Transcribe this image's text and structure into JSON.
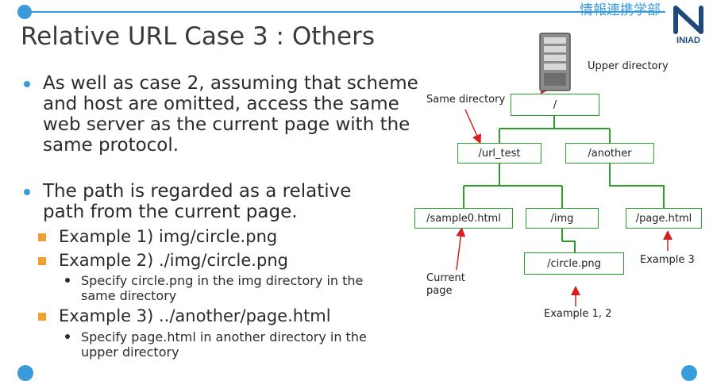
{
  "header": {
    "department": "情報連携学部",
    "logo_text": "INIAD",
    "accent": "#3a9bdc"
  },
  "slide": {
    "title": "Relative URL Case 3 : Others",
    "bullets": [
      "As well as case 2, assuming that scheme and host are omitted, access the same web server as the current page with the same protocol.",
      "The path is regarded as a relative path from the current page."
    ],
    "examples": [
      "Example 1) img/circle.png",
      "Example 2) ./img/circle.png",
      "Example 3) ../another/page.html"
    ],
    "example2_note": "Specify circle.png in the img directory in the same directory",
    "example3_note": "Specify page.html in another directory in the upper directory"
  },
  "diagram": {
    "upper_label": "Upper directory",
    "same_label": "Same directory",
    "current_label": "Current page",
    "ex12_label": "Example 1, 2",
    "ex3_label": "Example 3",
    "nodes": {
      "root": "/",
      "url_test": "/url_test",
      "another": "/another",
      "sample0": "/sample0.html",
      "img": "/img",
      "page": "/page.html",
      "circle": "/circle.png"
    },
    "tree_color": "#2aa02a",
    "arrow_color": "#d42020"
  }
}
